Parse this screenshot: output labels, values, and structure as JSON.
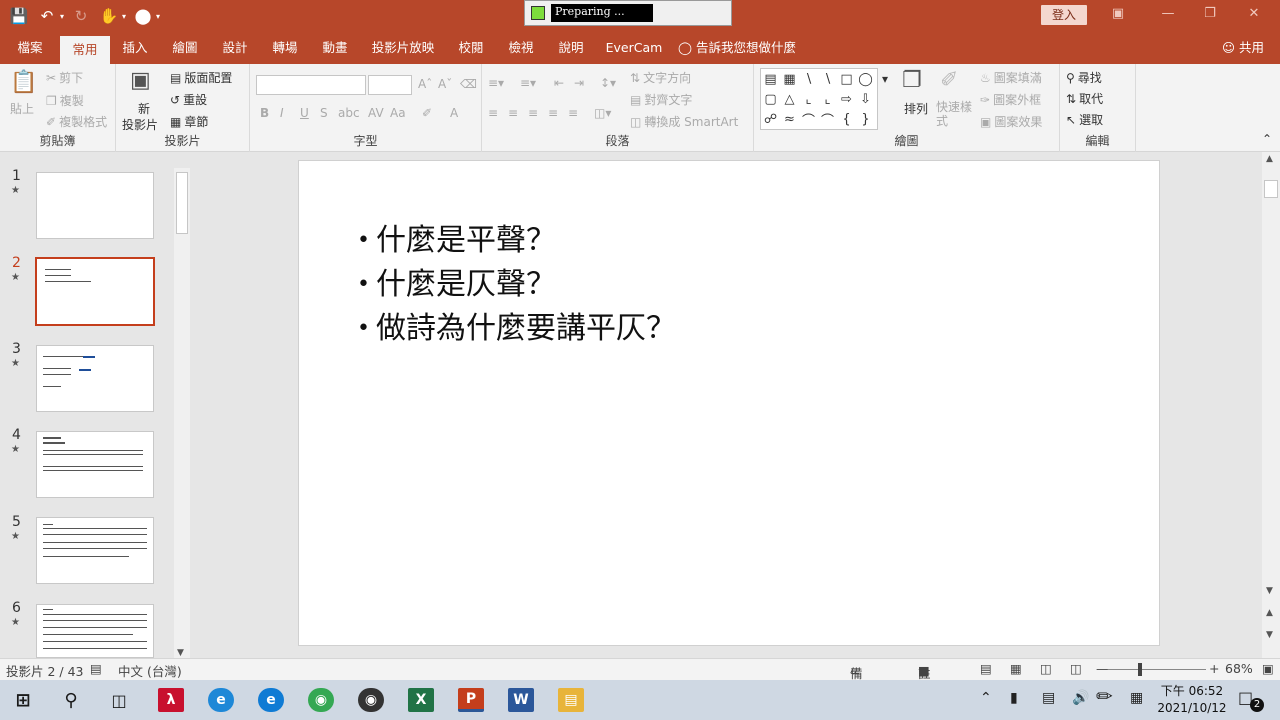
{
  "titlebar": {
    "preparing_text": "Preparing ...",
    "login_label": "登入"
  },
  "tabs": [
    {
      "label": "檔案"
    },
    {
      "label": "常用"
    },
    {
      "label": "插入"
    },
    {
      "label": "繪圖"
    },
    {
      "label": "設計"
    },
    {
      "label": "轉場"
    },
    {
      "label": "動畫"
    },
    {
      "label": "投影片放映"
    },
    {
      "label": "校閱"
    },
    {
      "label": "檢視"
    },
    {
      "label": "說明"
    },
    {
      "label": "EverCam"
    },
    {
      "label": "告訴我您想做什麼"
    }
  ],
  "share_label": "共用",
  "ribbon": {
    "clipboard": {
      "paste": "貼上",
      "cut": "剪下",
      "copy": "複製",
      "format_painter": "複製格式",
      "label": "剪貼簿"
    },
    "slides": {
      "new_slide_line1": "新",
      "new_slide_line2": "投影片",
      "layout": "版面配置",
      "reset": "重設",
      "section": "章節",
      "label": "投影片"
    },
    "font": {
      "label": "字型"
    },
    "paragraph": {
      "text_direction": "文字方向",
      "align_text": "對齊文字",
      "smartart": "轉換成 SmartArt",
      "label": "段落"
    },
    "drawing": {
      "arrange": "排列",
      "quick_styles": "快速樣式",
      "shape_fill": "圖案填滿",
      "shape_outline": "圖案外框",
      "shape_effects": "圖案效果",
      "label": "繪圖"
    },
    "editing": {
      "find": "尋找",
      "replace": "取代",
      "select": "選取",
      "label": "編輯"
    }
  },
  "thumbnails": [
    {
      "num": "1"
    },
    {
      "num": "2"
    },
    {
      "num": "3"
    },
    {
      "num": "4"
    },
    {
      "num": "5"
    },
    {
      "num": "6"
    }
  ],
  "slide": {
    "bullets": [
      "什麼是平聲？",
      "什麼是仄聲？",
      "做詩為什麼要講平仄？"
    ]
  },
  "status": {
    "slide_count": "投影片 2 / 43",
    "language": "中文 (台灣)",
    "notes": "備忘稿",
    "comments": "註解",
    "zoom": "68%"
  },
  "clock": {
    "time": "下午 06:52",
    "date": "2021/10/12"
  },
  "notification_count": "2",
  "colors": {
    "accent": "#b7472a",
    "ribbon_bg": "#f3f3f3",
    "selected_thumb": "#c43e1c"
  }
}
